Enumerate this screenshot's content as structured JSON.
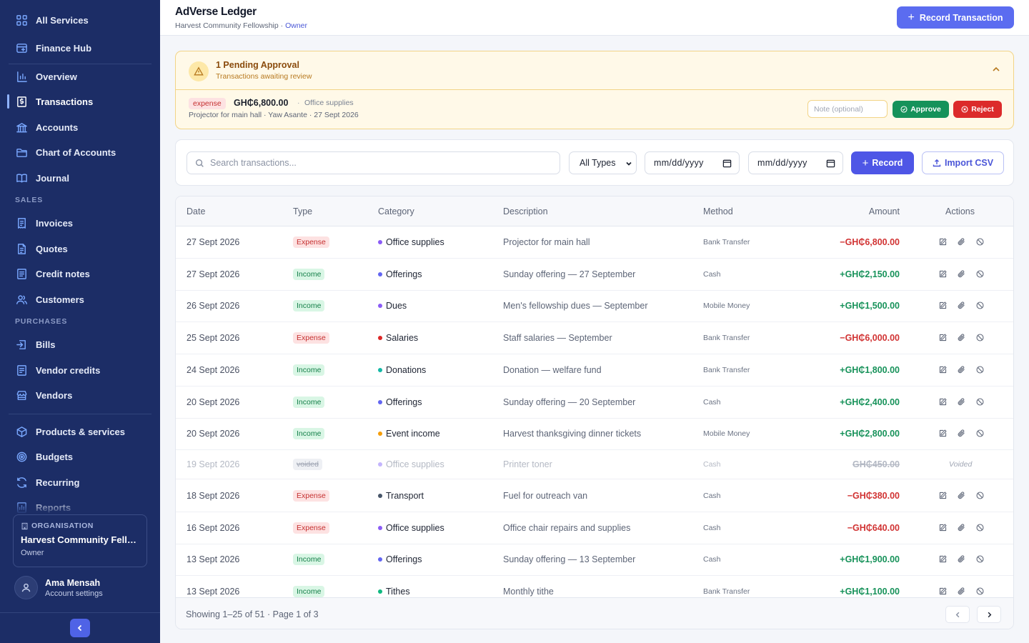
{
  "sidebar": {
    "top_items": [
      {
        "label": "All Services",
        "icon": "grid-icon"
      },
      {
        "label": "Finance Hub",
        "icon": "window-icon"
      }
    ],
    "main_items": [
      {
        "label": "Overview",
        "icon": "bar-chart-icon"
      },
      {
        "label": "Transactions",
        "icon": "receipt-dollar-icon",
        "active": true
      },
      {
        "label": "Accounts",
        "icon": "bank-icon"
      },
      {
        "label": "Chart of Accounts",
        "icon": "folder-icon"
      },
      {
        "label": "Journal",
        "icon": "book-icon"
      }
    ],
    "sales_label": "SALES",
    "sales_items": [
      {
        "label": "Invoices",
        "icon": "invoice-icon"
      },
      {
        "label": "Quotes",
        "icon": "quote-doc-icon"
      },
      {
        "label": "Credit notes",
        "icon": "credit-note-icon"
      },
      {
        "label": "Customers",
        "icon": "users-icon"
      }
    ],
    "purchases_label": "PURCHASES",
    "purchases_items": [
      {
        "label": "Bills",
        "icon": "bill-icon"
      },
      {
        "label": "Vendor credits",
        "icon": "vendor-credit-icon"
      },
      {
        "label": "Vendors",
        "icon": "store-icon"
      }
    ],
    "bottom_items": [
      {
        "label": "Products & services",
        "icon": "box-icon"
      },
      {
        "label": "Budgets",
        "icon": "target-icon"
      },
      {
        "label": "Recurring",
        "icon": "refresh-icon"
      },
      {
        "label": "Reports",
        "icon": "report-icon"
      }
    ],
    "org": {
      "label": "ORGANISATION",
      "name": "Harvest Community Fello...",
      "role": "Owner"
    },
    "user": {
      "name": "Ama Mensah",
      "sub": "Account settings"
    }
  },
  "header": {
    "title": "AdVerse Ledger",
    "org": "Harvest Community Fellowship",
    "separator": "·",
    "role": "Owner",
    "record_button": "Record Transaction"
  },
  "pending": {
    "title": "1 Pending Approval",
    "subtitle": "Transactions awaiting review",
    "item": {
      "type": "expense",
      "amount": "GH₵6,800.00",
      "dot": "·",
      "category": "Office supplies",
      "details": "Projector for main hall · Yaw Asante · 27 Sept 2026"
    },
    "note_placeholder": "Note (optional)",
    "approve": "Approve",
    "reject": "Reject"
  },
  "filters": {
    "search_placeholder": "Search transactions...",
    "type_value": "All Types",
    "date_from": "mm/dd/yyyy",
    "date_to": "mm/dd/yyyy",
    "record": "Record",
    "import": "Import CSV"
  },
  "table": {
    "columns": [
      "Date",
      "Type",
      "Category",
      "Description",
      "Method",
      "Amount",
      "Actions"
    ],
    "rows": [
      {
        "date": "27 Sept 2026",
        "type": "Expense",
        "kind": "expense",
        "category": "Office supplies",
        "cat_color": "#8b5cf6",
        "description": "Projector for main hall",
        "method": "Bank Transfer",
        "amount": "−GH₵6,800.00"
      },
      {
        "date": "27 Sept 2026",
        "type": "Income",
        "kind": "income",
        "category": "Offerings",
        "cat_color": "#6366f1",
        "description": "Sunday offering — 27 September",
        "method": "Cash",
        "amount": "+GH₵2,150.00"
      },
      {
        "date": "26 Sept 2026",
        "type": "Income",
        "kind": "income",
        "category": "Dues",
        "cat_color": "#8b5cf6",
        "description": "Men's fellowship dues — September",
        "method": "Mobile Money",
        "amount": "+GH₵1,500.00"
      },
      {
        "date": "25 Sept 2026",
        "type": "Expense",
        "kind": "expense",
        "category": "Salaries",
        "cat_color": "#dc2626",
        "description": "Staff salaries — September",
        "method": "Bank Transfer",
        "amount": "−GH₵6,000.00"
      },
      {
        "date": "24 Sept 2026",
        "type": "Income",
        "kind": "income",
        "category": "Donations",
        "cat_color": "#14b8a6",
        "description": "Donation — welfare fund",
        "method": "Bank Transfer",
        "amount": "+GH₵1,800.00"
      },
      {
        "date": "20 Sept 2026",
        "type": "Income",
        "kind": "income",
        "category": "Offerings",
        "cat_color": "#6366f1",
        "description": "Sunday offering — 20 September",
        "method": "Cash",
        "amount": "+GH₵2,400.00"
      },
      {
        "date": "20 Sept 2026",
        "type": "Income",
        "kind": "income",
        "category": "Event income",
        "cat_color": "#f59e0b",
        "description": "Harvest thanksgiving dinner tickets",
        "method": "Mobile Money",
        "amount": "+GH₵2,800.00"
      },
      {
        "date": "19 Sept 2026",
        "type": "voided",
        "kind": "voided",
        "category": "Office supplies",
        "cat_color": "#c4b5fd",
        "description": "Printer toner",
        "method": "Cash",
        "amount": "GH₵450.00",
        "voided_label": "Voided"
      },
      {
        "date": "18 Sept 2026",
        "type": "Expense",
        "kind": "expense",
        "category": "Transport",
        "cat_color": "#475569",
        "description": "Fuel for outreach van",
        "method": "Cash",
        "amount": "−GH₵380.00"
      },
      {
        "date": "16 Sept 2026",
        "type": "Expense",
        "kind": "expense",
        "category": "Office supplies",
        "cat_color": "#8b5cf6",
        "description": "Office chair repairs and supplies",
        "method": "Cash",
        "amount": "−GH₵640.00"
      },
      {
        "date": "13 Sept 2026",
        "type": "Income",
        "kind": "income",
        "category": "Offerings",
        "cat_color": "#6366f1",
        "description": "Sunday offering — 13 September",
        "method": "Cash",
        "amount": "+GH₵1,900.00"
      },
      {
        "date": "13 Sept 2026",
        "type": "Income",
        "kind": "income",
        "category": "Tithes",
        "cat_color": "#10b981",
        "description": "Monthly tithe",
        "method": "Bank Transfer",
        "amount": "+GH₵1,100.00"
      }
    ],
    "footer": "Showing 1–25 of 51 · Page 1 of 3"
  }
}
